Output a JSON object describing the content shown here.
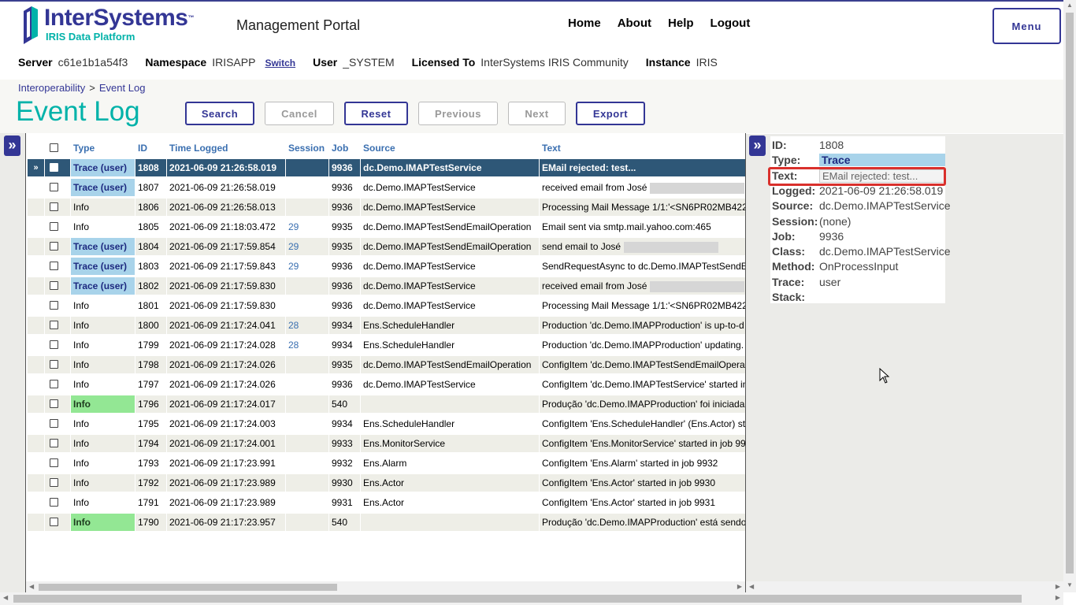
{
  "header": {
    "logo_name": "InterSystems",
    "logo_tm": "™",
    "logo_sub": "IRIS Data Platform",
    "portal_title": "Management Portal",
    "nav": [
      "Home",
      "About",
      "Help",
      "Logout"
    ],
    "menu_label": "Menu"
  },
  "info": {
    "server_label": "Server",
    "server": "c61e1b1a54f3",
    "namespace_label": "Namespace",
    "namespace": "IRISAPP",
    "switch": "Switch",
    "user_label": "User",
    "user": "_SYSTEM",
    "licensed_label": "Licensed To",
    "licensed": "InterSystems IRIS Community",
    "instance_label": "Instance",
    "instance": "IRIS"
  },
  "breadcrumb": {
    "parent": "Interoperability",
    "sep": ">",
    "current": "Event Log"
  },
  "page_title": "Event Log",
  "toolbar": {
    "search": "Search",
    "cancel": "Cancel",
    "reset": "Reset",
    "previous": "Previous",
    "next": "Next",
    "export": "Export"
  },
  "expand_icon": "»",
  "table": {
    "columns": [
      "Type",
      "ID",
      "Time Logged",
      "Session",
      "Job",
      "Source",
      "Text"
    ],
    "selected_marker": "»",
    "rows": [
      {
        "type": "Trace (user)",
        "style": "trace",
        "id": "1808",
        "time": "2021-06-09 21:26:58.019",
        "session": "",
        "job": "9936",
        "source": "dc.Demo.IMAPTestService",
        "text": "EMail rejected: test...",
        "selected": true
      },
      {
        "type": "Trace (user)",
        "style": "trace",
        "id": "1807",
        "time": "2021-06-09 21:26:58.019",
        "session": "",
        "job": "9936",
        "source": "dc.Demo.IMAPTestService",
        "text": "received email from José",
        "blur": true
      },
      {
        "type": "Info",
        "style": "",
        "id": "1806",
        "time": "2021-06-09 21:26:58.013",
        "session": "",
        "job": "9936",
        "source": "dc.Demo.IMAPTestService",
        "text": "Processing Mail Message 1/1:'<SN6PR02MB422"
      },
      {
        "type": "Info",
        "style": "",
        "id": "1805",
        "time": "2021-06-09 21:18:03.472",
        "session": "29",
        "job": "9935",
        "source": "dc.Demo.IMAPTestSendEmailOperation",
        "text": "Email sent via smtp.mail.yahoo.com:465"
      },
      {
        "type": "Trace (user)",
        "style": "trace",
        "id": "1804",
        "time": "2021-06-09 21:17:59.854",
        "session": "29",
        "job": "9935",
        "source": "dc.Demo.IMAPTestSendEmailOperation",
        "text": "send email to José",
        "blur": true
      },
      {
        "type": "Trace (user)",
        "style": "trace",
        "id": "1803",
        "time": "2021-06-09 21:17:59.843",
        "session": "29",
        "job": "9936",
        "source": "dc.Demo.IMAPTestService",
        "text": "SendRequestAsync to dc.Demo.IMAPTestSendE"
      },
      {
        "type": "Trace (user)",
        "style": "trace",
        "id": "1802",
        "time": "2021-06-09 21:17:59.830",
        "session": "",
        "job": "9936",
        "source": "dc.Demo.IMAPTestService",
        "text": "received email from José",
        "blur": true
      },
      {
        "type": "Info",
        "style": "",
        "id": "1801",
        "time": "2021-06-09 21:17:59.830",
        "session": "",
        "job": "9936",
        "source": "dc.Demo.IMAPTestService",
        "text": "Processing Mail Message 1/1:'<SN6PR02MB422"
      },
      {
        "type": "Info",
        "style": "",
        "id": "1800",
        "time": "2021-06-09 21:17:24.041",
        "session": "28",
        "job": "9934",
        "source": "Ens.ScheduleHandler",
        "text": "Production 'dc.Demo.IMAPProduction' is up-to-d"
      },
      {
        "type": "Info",
        "style": "",
        "id": "1799",
        "time": "2021-06-09 21:17:24.028",
        "session": "28",
        "job": "9934",
        "source": "Ens.ScheduleHandler",
        "text": "Production 'dc.Demo.IMAPProduction' updating."
      },
      {
        "type": "Info",
        "style": "",
        "id": "1798",
        "time": "2021-06-09 21:17:24.026",
        "session": "",
        "job": "9935",
        "source": "dc.Demo.IMAPTestSendEmailOperation",
        "text": "ConfigItem 'dc.Demo.IMAPTestSendEmailOpera"
      },
      {
        "type": "Info",
        "style": "",
        "id": "1797",
        "time": "2021-06-09 21:17:24.026",
        "session": "",
        "job": "9936",
        "source": "dc.Demo.IMAPTestService",
        "text": "ConfigItem 'dc.Demo.IMAPTestService' started in"
      },
      {
        "type": "Info",
        "style": "green",
        "id": "1796",
        "time": "2021-06-09 21:17:24.017",
        "session": "",
        "job": "540",
        "source": "",
        "text": "Produção 'dc.Demo.IMAPProduction' foi iniciada"
      },
      {
        "type": "Info",
        "style": "",
        "id": "1795",
        "time": "2021-06-09 21:17:24.003",
        "session": "",
        "job": "9934",
        "source": "Ens.ScheduleHandler",
        "text": "ConfigItem 'Ens.ScheduleHandler' (Ens.Actor) st"
      },
      {
        "type": "Info",
        "style": "",
        "id": "1794",
        "time": "2021-06-09 21:17:24.001",
        "session": "",
        "job": "9933",
        "source": "Ens.MonitorService",
        "text": "ConfigItem 'Ens.MonitorService' started in job 99"
      },
      {
        "type": "Info",
        "style": "",
        "id": "1793",
        "time": "2021-06-09 21:17:23.991",
        "session": "",
        "job": "9932",
        "source": "Ens.Alarm",
        "text": "ConfigItem 'Ens.Alarm' started in job 9932"
      },
      {
        "type": "Info",
        "style": "",
        "id": "1792",
        "time": "2021-06-09 21:17:23.989",
        "session": "",
        "job": "9930",
        "source": "Ens.Actor",
        "text": "ConfigItem 'Ens.Actor' started in job 9930"
      },
      {
        "type": "Info",
        "style": "",
        "id": "1791",
        "time": "2021-06-09 21:17:23.989",
        "session": "",
        "job": "9931",
        "source": "Ens.Actor",
        "text": "ConfigItem 'Ens.Actor' started in job 9931"
      },
      {
        "type": "Info",
        "style": "green",
        "id": "1790",
        "time": "2021-06-09 21:17:23.957",
        "session": "",
        "job": "540",
        "source": "",
        "text": "Produção 'dc.Demo.IMAPProduction' está sendo"
      }
    ]
  },
  "details": [
    {
      "label": "ID:",
      "value": "1808"
    },
    {
      "label": "Type:",
      "value": "Trace",
      "kind": "type"
    },
    {
      "label": "Text:",
      "value": "EMail rejected: test...",
      "kind": "text"
    },
    {
      "label": "Logged:",
      "value": "2021-06-09 21:26:58.019"
    },
    {
      "label": "Source:",
      "value": "dc.Demo.IMAPTestService"
    },
    {
      "label": "Session:",
      "value": "(none)"
    },
    {
      "label": "Job:",
      "value": "9936"
    },
    {
      "label": "Class:",
      "value": "dc.Demo.IMAPTestService"
    },
    {
      "label": "Method:",
      "value": "OnProcessInput"
    },
    {
      "label": "Trace:",
      "value": "user"
    },
    {
      "label": "Stack:",
      "value": ""
    }
  ],
  "colors": {
    "brand": "#333695",
    "accent": "#00b2a9",
    "selected_row": "#2e5777",
    "trace_badge": "#a8d3ea",
    "info_green": "#93e794",
    "highlight": "#d9302c"
  }
}
